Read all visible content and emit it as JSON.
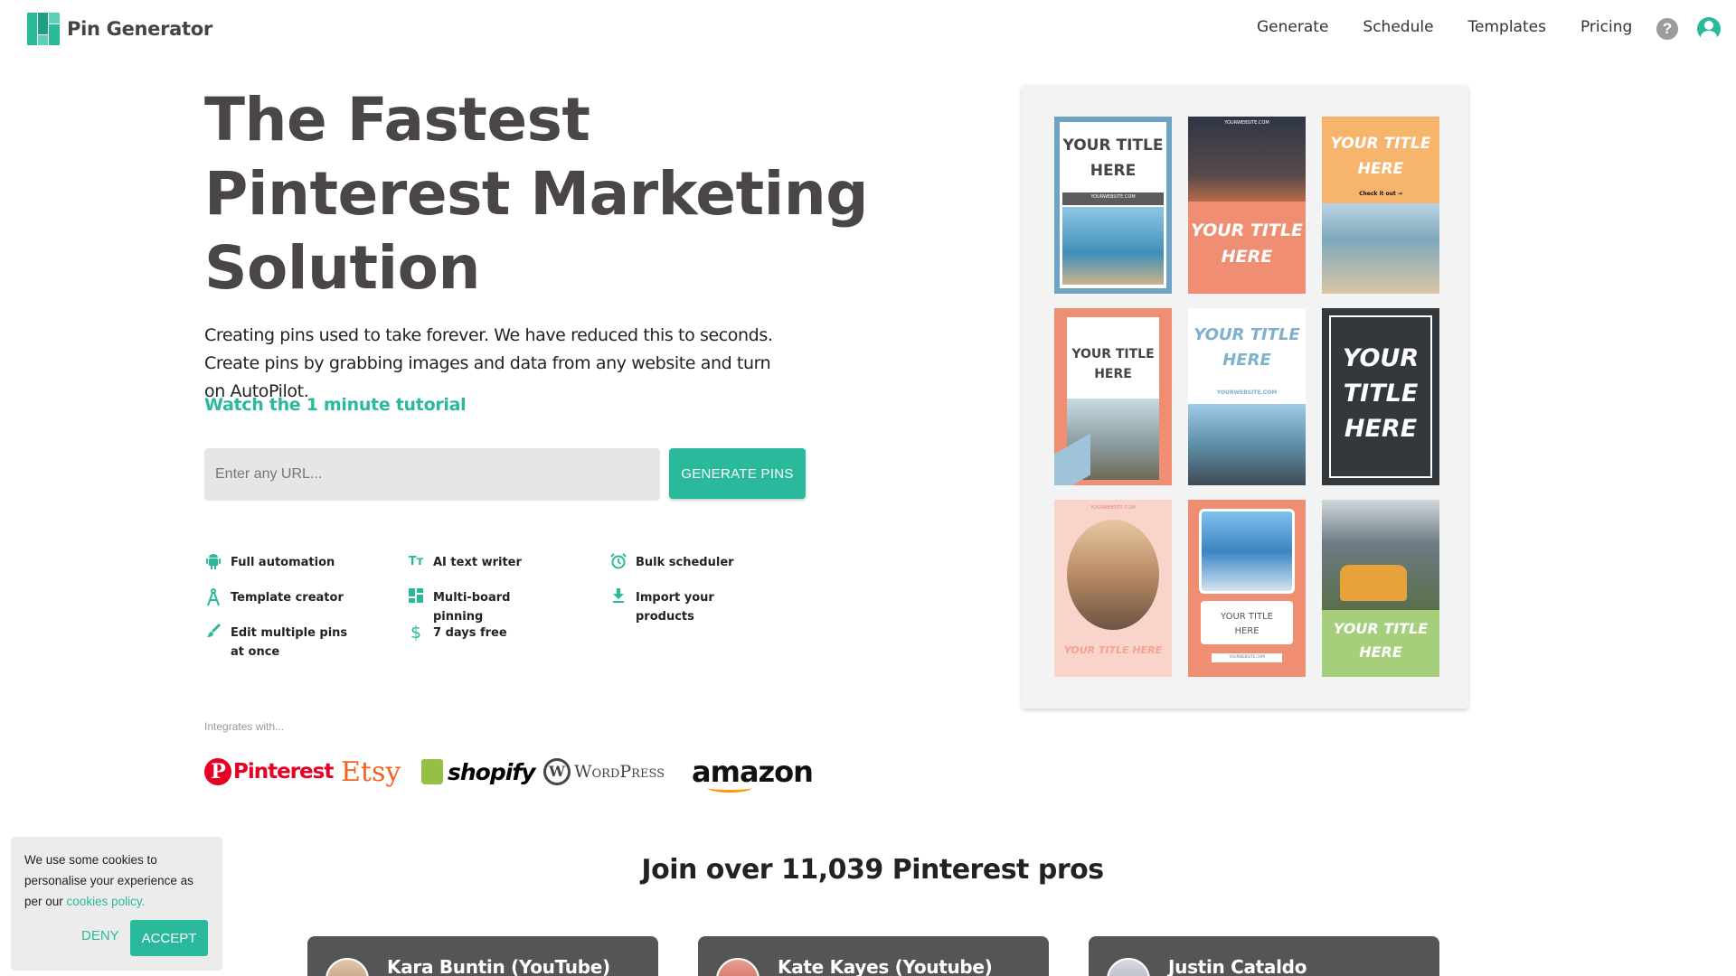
{
  "header": {
    "logo_text": "Pin Generator",
    "nav": [
      "Generate",
      "Schedule",
      "Templates",
      "Pricing"
    ],
    "help_icon": "?"
  },
  "hero": {
    "title_lines": [
      "The Fastest",
      "Pinterest Marketing",
      "Solution"
    ],
    "description": "Creating pins used to take forever. We have reduced this to seconds. Create pins by grabbing images and data from any website and turn on AutoPilot.",
    "tutorial_link": "Watch the 1 minute tutorial",
    "url_placeholder": "Enter any URL...",
    "generate_button": "GENERATE PINS"
  },
  "features": [
    {
      "label": "Full automation",
      "icon": "android-icon"
    },
    {
      "label": "AI text writer",
      "icon": "text-size-icon"
    },
    {
      "label": "Bulk scheduler",
      "icon": "alarm-clock-icon"
    },
    {
      "label": "Template creator",
      "icon": "compass-icon"
    },
    {
      "label": "Multi-board pinning",
      "icon": "grid-icon"
    },
    {
      "label": "Import your products",
      "icon": "download-icon"
    },
    {
      "label": "Edit multiple pins at once",
      "icon": "brush-icon"
    },
    {
      "label": "7 days free",
      "icon": "dollar-icon"
    }
  ],
  "integrations": {
    "label": "Integrates with...",
    "brands": [
      "Pinterest",
      "Etsy",
      "shopify",
      "WordPress",
      "amazon"
    ]
  },
  "pins": [
    {
      "title": "YOUR TITLE HERE",
      "website": "YOURWEBSITE.COM"
    },
    {
      "title": "YOUR TITLE HERE",
      "website": "YOURWEBSITE.COM"
    },
    {
      "title": "YOUR TITLE HERE",
      "cta": "Check it out →"
    },
    {
      "title": "YOUR TITLE HERE"
    },
    {
      "title": "YOUR TITLE HERE",
      "website": "YOURWEBSITE.COM"
    },
    {
      "title": "YOUR TITLE HERE"
    },
    {
      "title": "YOUR TITLE HERE",
      "website": "YOURWEBSITE.COM"
    },
    {
      "title": "YOUR TITLE HERE",
      "website": "YOURWEBSITE.COM"
    },
    {
      "title": "YOUR TITLE HERE"
    }
  ],
  "join": {
    "title": "Join over 11,039 Pinterest pros",
    "testimonials": [
      {
        "name": "Kara Buntin (YouTube)"
      },
      {
        "name": "Kate Kayes (Youtube)"
      },
      {
        "name": "Justin Cataldo"
      }
    ]
  },
  "cookie": {
    "message": "We use some cookies to personalise your experience as per our",
    "link": "cookies policy.",
    "deny": "DENY",
    "accept": "ACCEPT"
  },
  "colors": {
    "accent": "#2ab99a",
    "title": "#4a4646"
  }
}
